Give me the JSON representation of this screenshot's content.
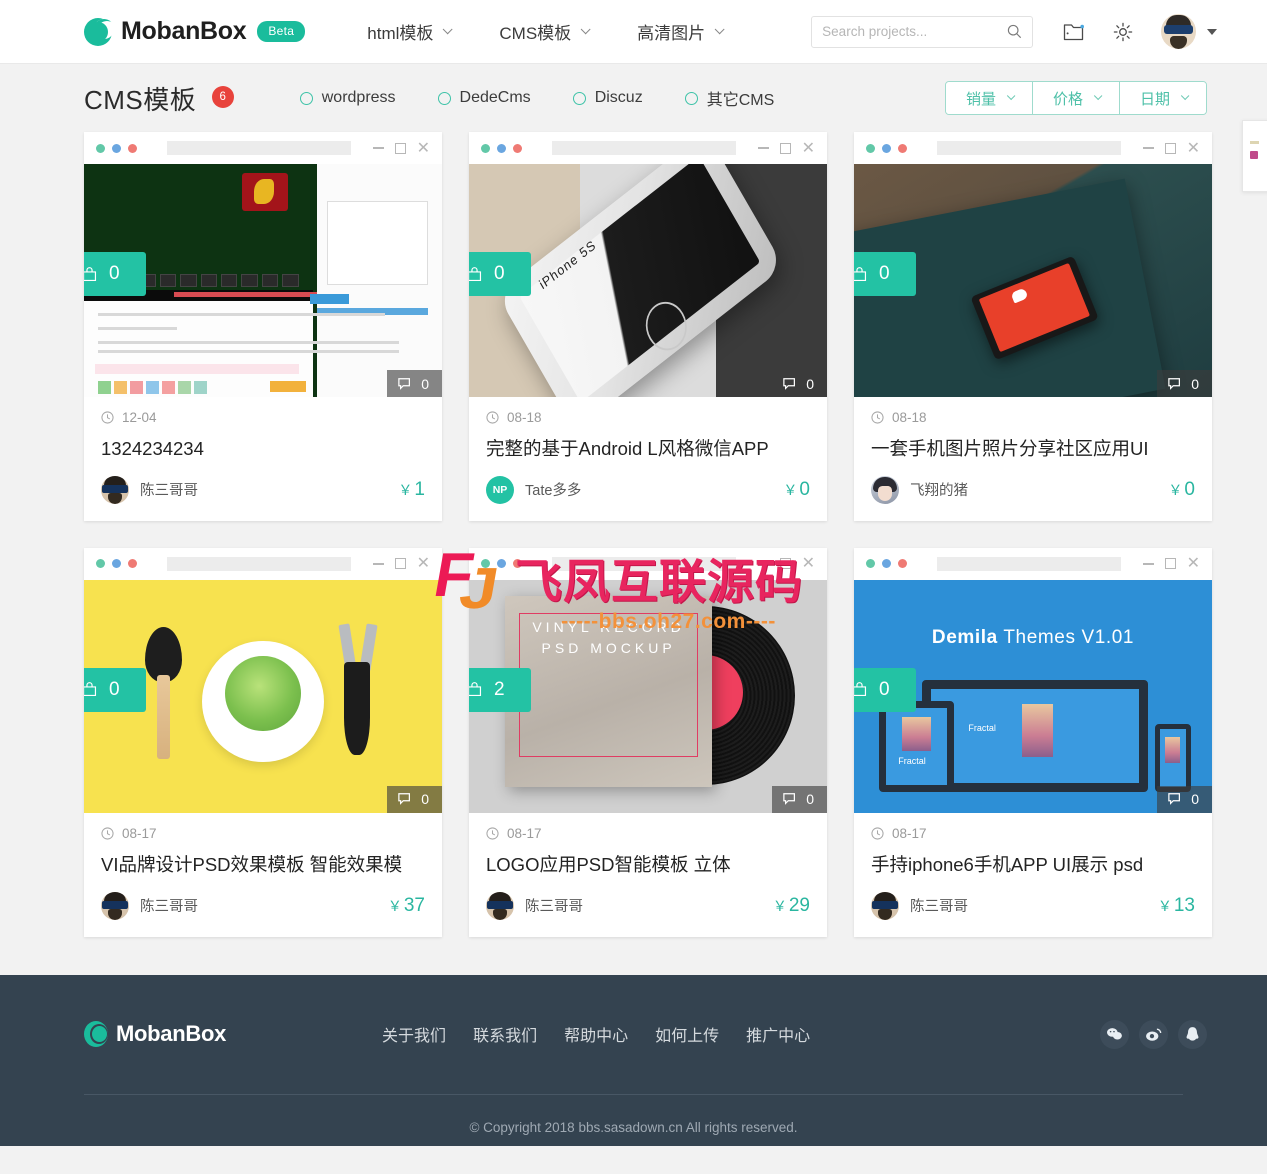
{
  "header": {
    "brand": "MobanBox",
    "beta": "Beta",
    "nav": [
      {
        "label": "html模板",
        "icon": "chevron-down-icon"
      },
      {
        "label": "CMS模板",
        "icon": "chevron-down-icon"
      },
      {
        "label": "高清图片",
        "icon": "chevron-down-icon"
      }
    ],
    "search": {
      "value": "",
      "placeholder": "Search projects..."
    },
    "icons": [
      "wallet-icon",
      "gear-icon",
      "avatar"
    ]
  },
  "pagehead": {
    "title": "CMS模板",
    "count": "6",
    "filters": [
      {
        "label": "wordpress"
      },
      {
        "label": "DedeCms"
      },
      {
        "label": "Discuz"
      },
      {
        "label": "其它CMS"
      }
    ],
    "sorts": [
      {
        "label": "销量"
      },
      {
        "label": "价格"
      },
      {
        "label": "日期"
      }
    ]
  },
  "cards": [
    {
      "art": "art-dragon",
      "sales": "0",
      "comments": "0",
      "date": "12-04",
      "title": "1324234234",
      "author": "陈三哥哥",
      "avatar_kind": "sun",
      "avatar_text": "",
      "currency": "￥",
      "price": "1"
    },
    {
      "art": "art-iphone",
      "sales": "0",
      "comments": "0",
      "date": "08-18",
      "title": "完整的基于Android L风格微信APP",
      "author": "Tate多多",
      "avatar_kind": "np",
      "avatar_text": "NP",
      "currency": "￥",
      "price": "0"
    },
    {
      "art": "art-desk",
      "sales": "0",
      "comments": "0",
      "date": "08-18",
      "title": "一套手机图片照片分享社区应用UI",
      "author": "飞翔的猪",
      "avatar_kind": "anime",
      "avatar_text": "",
      "currency": "￥",
      "price": "0"
    },
    {
      "art": "art-tools",
      "sales": "0",
      "comments": "0",
      "date": "08-17",
      "title": "VI品牌设计PSD效果模板 智能效果模",
      "author": "陈三哥哥",
      "avatar_kind": "sun",
      "avatar_text": "",
      "currency": "￥",
      "price": "37"
    },
    {
      "art": "art-vinyl",
      "sales": "2",
      "comments": "0",
      "date": "08-17",
      "title": "LOGO应用PSD智能模板 立体",
      "author": "陈三哥哥",
      "avatar_kind": "sun",
      "avatar_text": "",
      "currency": "￥",
      "price": "29"
    },
    {
      "art": "art-demila",
      "sales": "0",
      "comments": "0",
      "date": "08-17",
      "title": "手持iphone6手机APP UI展示 psd",
      "author": "陈三哥哥",
      "avatar_kind": "sun",
      "avatar_text": "",
      "currency": "￥",
      "price": "13"
    }
  ],
  "card_art_text": {
    "iphone_label": "iPhone 5S",
    "vinyl_text": "VINYL RECORD PSD MOCKUP",
    "demila_title_bold": "Demila",
    "demila_title_rest": " Themes V1.01",
    "demila_sub": "Fractal"
  },
  "watermark": {
    "logo": "FJ",
    "text": "飞凤互联源码",
    "url": "-----bbs.oh27.com----"
  },
  "footer": {
    "brand": "MobanBox",
    "links": [
      "关于我们",
      "联系我们",
      "帮助中心",
      "如何上传",
      "推广中心"
    ],
    "social": [
      "wechat-icon",
      "weibo-icon",
      "qq-icon"
    ],
    "copyright": "© Copyright 2018 bbs.sasadown.cn All rights reserved."
  },
  "colors": {
    "accent": "#1abc9c",
    "ribbon": "#23c2a4",
    "badge_red": "#e8433c",
    "footer_bg": "#344350",
    "price": "#2ab6a0"
  }
}
